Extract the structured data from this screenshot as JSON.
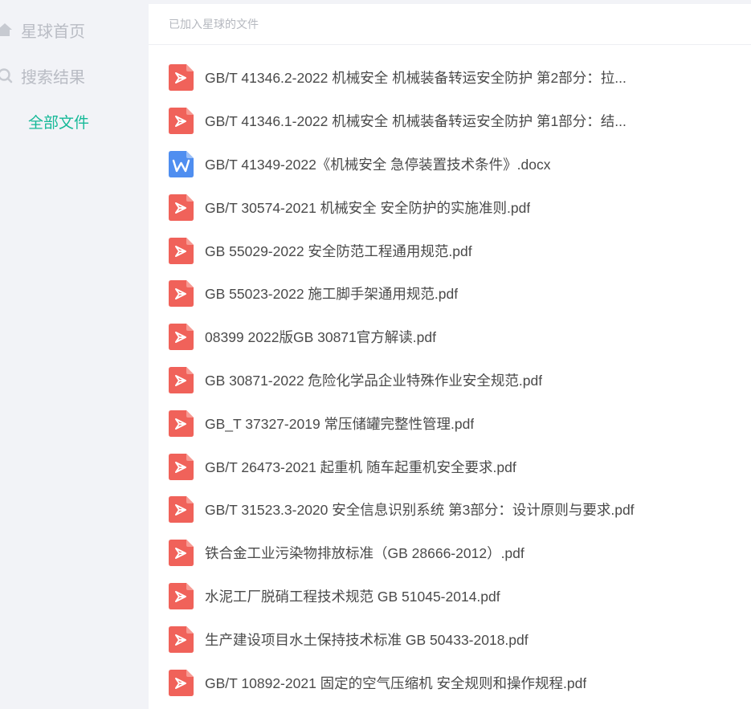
{
  "sidebar": {
    "items": [
      {
        "label": "星球首页",
        "icon": "home-icon"
      },
      {
        "label": "搜索结果",
        "icon": "search-icon"
      },
      {
        "label": "全部文件",
        "icon": ""
      }
    ],
    "active_color": "#16b998"
  },
  "main": {
    "header": "已加入星球的文件",
    "files": [
      {
        "name": "GB/T 41346.2-2022 机械安全 机械装备转运安全防护 第2部分：拉...",
        "type": "pdf"
      },
      {
        "name": "GB/T 41346.1-2022 机械安全 机械装备转运安全防护 第1部分：结...",
        "type": "pdf"
      },
      {
        "name": "GB/T 41349-2022《机械安全 急停装置技术条件》.docx",
        "type": "docx"
      },
      {
        "name": "GB/T 30574-2021 机械安全 安全防护的实施准则.pdf",
        "type": "pdf"
      },
      {
        "name": "GB 55029-2022 安全防范工程通用规范.pdf",
        "type": "pdf"
      },
      {
        "name": "GB 55023-2022 施工脚手架通用规范.pdf",
        "type": "pdf"
      },
      {
        "name": "08399 2022版GB 30871官方解读.pdf",
        "type": "pdf"
      },
      {
        "name": "GB 30871-2022 危险化学品企业特殊作业安全规范.pdf",
        "type": "pdf"
      },
      {
        "name": "GB_T 37327-2019 常压储罐完整性管理.pdf",
        "type": "pdf"
      },
      {
        "name": "GB/T 26473-2021 起重机 随车起重机安全要求.pdf",
        "type": "pdf"
      },
      {
        "name": "GB/T 31523.3-2020 安全信息识别系统 第3部分：设计原则与要求.pdf",
        "type": "pdf"
      },
      {
        "name": "铁合金工业污染物排放标准（GB 28666-2012）.pdf",
        "type": "pdf"
      },
      {
        "name": "水泥工厂脱硝工程技术规范 GB 51045-2014.pdf",
        "type": "pdf"
      },
      {
        "name": "生产建设项目水土保持技术标准 GB 50433-2018.pdf",
        "type": "pdf"
      },
      {
        "name": "GB/T 10892-2021 固定的空气压缩机 安全规则和操作规程.pdf",
        "type": "pdf"
      }
    ]
  },
  "colors": {
    "pdf": "#f0625a",
    "docx": "#4f8ef0"
  }
}
